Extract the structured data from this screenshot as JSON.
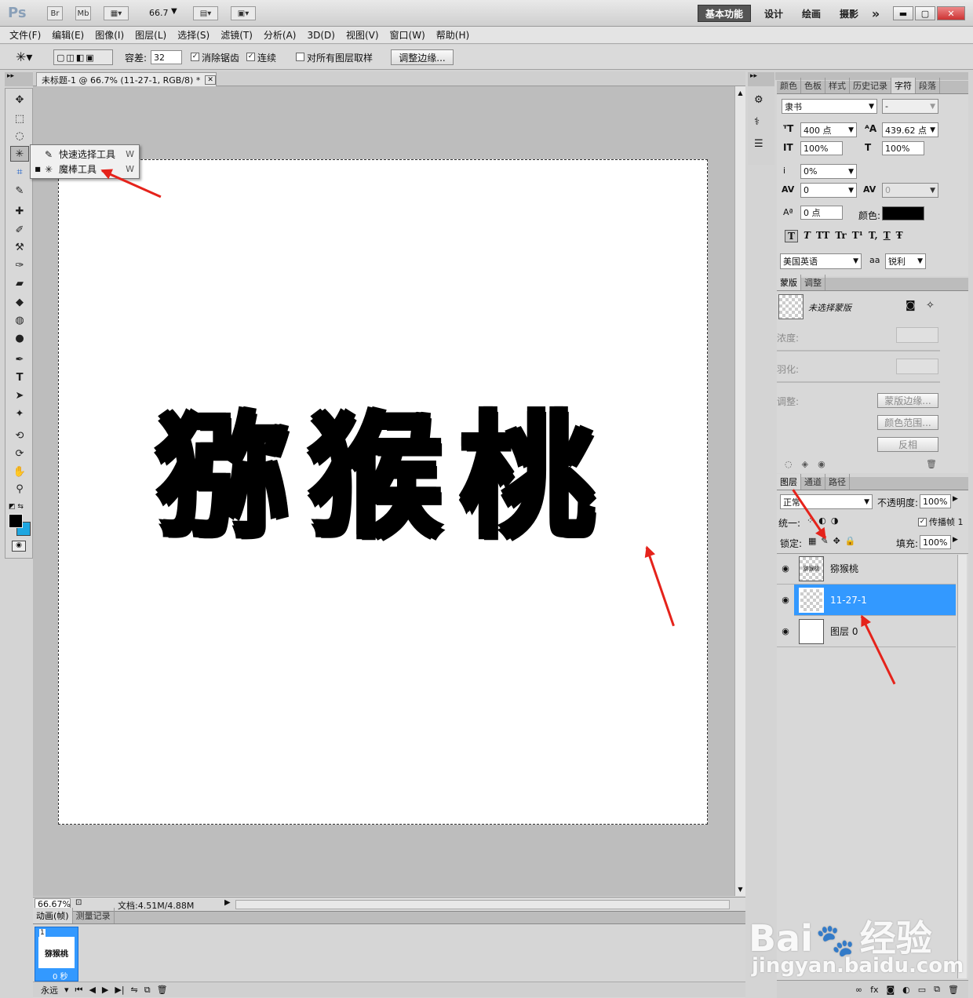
{
  "appbar": {
    "logo": "Ps",
    "br": "Br",
    "mb": "Mb",
    "zoom": "66.7",
    "workspaces": [
      "设计",
      "绘画",
      "摄影"
    ],
    "active_workspace": "基本功能",
    "more": "»"
  },
  "menu": [
    "文件(F)",
    "编辑(E)",
    "图像(I)",
    "图层(L)",
    "选择(S)",
    "滤镜(T)",
    "分析(A)",
    "3D(D)",
    "视图(V)",
    "窗口(W)",
    "帮助(H)"
  ],
  "options": {
    "tolerance_label": "容差:",
    "tolerance_value": "32",
    "antialias_label": "消除锯齿",
    "contiguous_label": "连续",
    "all_layers_label": "对所有图层取样",
    "refine_button": "调整边缘..."
  },
  "document": {
    "tab_title": "未标题-1 @ 66.7% (11-27-1, RGB/8) *",
    "canvas_text": "猕猴桃",
    "zoom_status": "66.67%",
    "doc_status": "文档:4.51M/4.88M"
  },
  "flyout": {
    "items": [
      {
        "label": "快速选择工具",
        "key": "W"
      },
      {
        "label": "魔棒工具",
        "key": "W"
      }
    ]
  },
  "animation": {
    "tabs": [
      "动画(帧)",
      "测量记录"
    ],
    "frame_number": "1",
    "frame_thumb_text": "猕猴桃",
    "frame_time": "0 秒",
    "loop": "永远"
  },
  "char_panel": {
    "tabs": [
      "颜色",
      "色板",
      "样式",
      "历史记录",
      "字符",
      "段落"
    ],
    "font_family": "隶书",
    "font_style": "-",
    "size": "400 点",
    "leading": "439.62 点",
    "vscale": "100%",
    "hscale": "100%",
    "tsume": "0%",
    "kerning": "0",
    "tracking": "0",
    "baseline": "0 点",
    "color_label": "颜色:",
    "language": "美国英语",
    "aa_label": "aa",
    "aa_value": "锐利",
    "style_buttons": [
      "T",
      "T",
      "TT",
      "Tr",
      "T¹",
      "T,",
      "T",
      "Ŧ"
    ]
  },
  "mask_panel": {
    "tabs": [
      "蒙版",
      "调整"
    ],
    "status": "未选择蒙版",
    "density_label": "浓度:",
    "feather_label": "羽化:",
    "adjust_label": "调整:",
    "btn_edge": "蒙版边缘...",
    "btn_range": "颜色范围...",
    "btn_invert": "反相"
  },
  "layers_panel": {
    "tabs": [
      "图层",
      "通道",
      "路径"
    ],
    "blend_mode": "正常",
    "opacity_label": "不透明度:",
    "opacity": "100%",
    "unify_label": "统一:",
    "propagate_label": "传播帧 1",
    "lock_label": "锁定:",
    "fill_label": "填充:",
    "fill": "100%",
    "layers": [
      {
        "name": "猕猴桃",
        "selected": false
      },
      {
        "name": "11-27-1",
        "selected": true
      },
      {
        "name": "图层 0",
        "selected": false
      }
    ]
  },
  "watermark": {
    "brand": "Bai",
    "brand2": "经验",
    "url": "jingyan.baidu.com"
  },
  "colors": {
    "selection_blue": "#3399ff",
    "arrow_red": "#e5231b"
  }
}
